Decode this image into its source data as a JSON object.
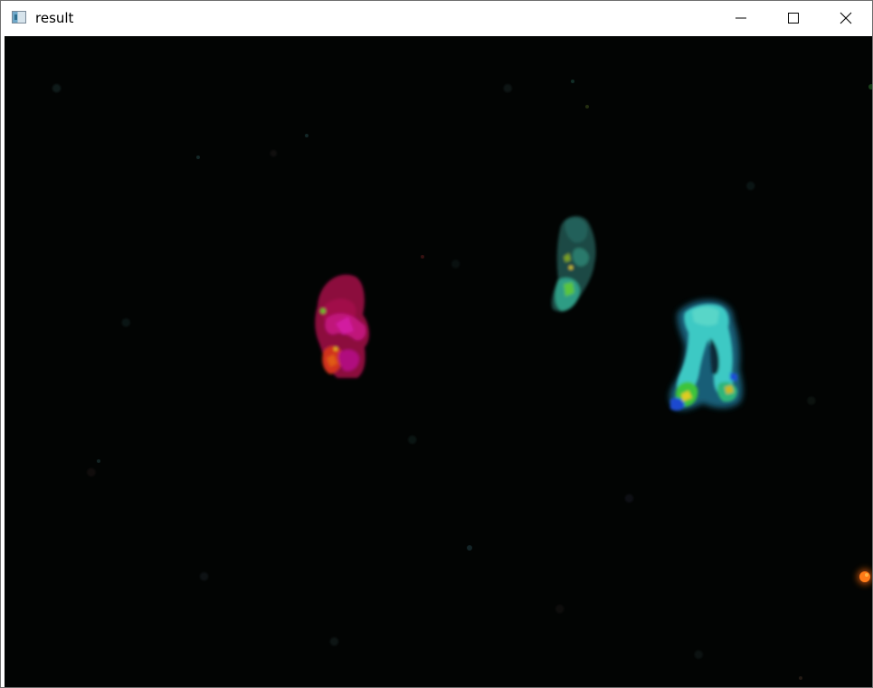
{
  "window": {
    "title": "result",
    "icon": "opencv-window-icon",
    "controls": [
      "minimize-icon",
      "maximize-icon",
      "close-icon"
    ]
  },
  "canvas": {
    "description_colors": {
      "background": "#020403",
      "magenta_blob": "#c0106a",
      "teal_blob": "#2fa08c",
      "cyan_blob": "#3ec9c4",
      "orange_dot": "#ff6a10"
    }
  }
}
